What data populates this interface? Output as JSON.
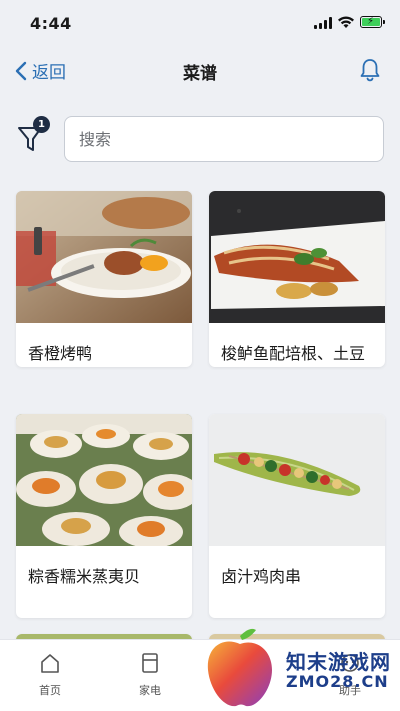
{
  "status_bar": {
    "time": "4:44"
  },
  "header": {
    "back_label": "返回",
    "title": "菜谱"
  },
  "filter": {
    "badge_count": "1"
  },
  "search": {
    "placeholder": "搜索"
  },
  "recipes": [
    {
      "name": "香橙烤鸭"
    },
    {
      "name": "梭鲈鱼配培根、土豆和扁豆"
    },
    {
      "name": "粽香糯米蒸夷贝"
    },
    {
      "name": "卤汁鸡肉串"
    }
  ],
  "bottom_nav": {
    "items": [
      {
        "label": "首页",
        "icon": "home-icon"
      },
      {
        "label": "家电",
        "icon": "appliance-icon"
      },
      {
        "label": "助手",
        "icon": "assistant-icon"
      }
    ]
  },
  "watermark": {
    "cn": "知末游戏网",
    "en": "ZMO28.CN"
  },
  "colors": {
    "accent": "#2b6fb4",
    "background": "#eef0f4",
    "badge": "#1f2d44"
  }
}
